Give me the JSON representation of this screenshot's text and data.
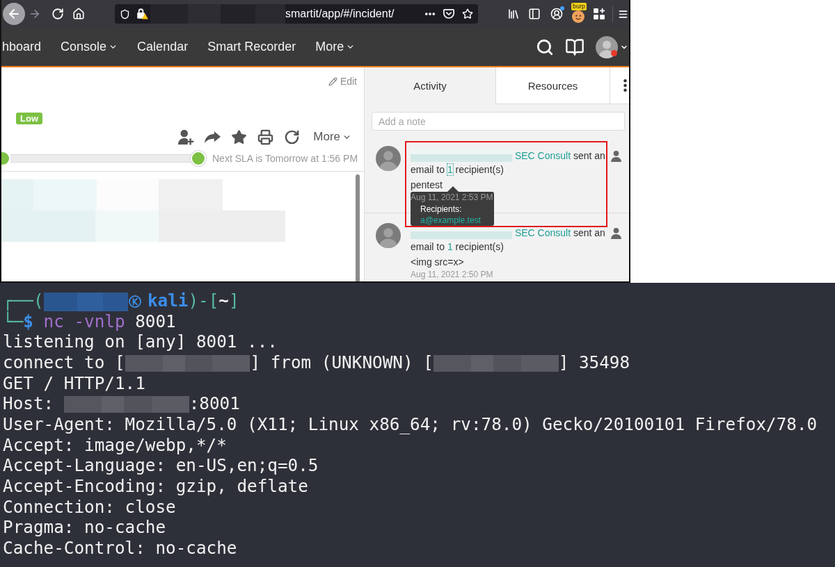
{
  "browser": {
    "toolbar": {
      "url": "smartit/app/#/incident/",
      "extension_badge": "burp"
    },
    "nav": {
      "items": [
        {
          "label": "hboard",
          "dropdown": false
        },
        {
          "label": "Console",
          "dropdown": true
        },
        {
          "label": "Calendar",
          "dropdown": false
        },
        {
          "label": "Smart Recorder",
          "dropdown": false
        },
        {
          "label": "More",
          "dropdown": true
        }
      ]
    },
    "incident": {
      "edit": "Edit",
      "priority": "Low",
      "more": "More",
      "sla": "Next SLA is Tomorrow at 1:56 PM"
    },
    "activity_panel": {
      "tabs": [
        {
          "label": "Activity",
          "selected": true
        },
        {
          "label": "Resources",
          "selected": false
        }
      ],
      "note": {
        "placeholder": "Add a note"
      },
      "entries": [
        {
          "author": "SEC Consult",
          "action": "sent an email to",
          "count": "1",
          "count_suffix": "recipient(s)",
          "count_focused": true,
          "body": "pentest",
          "time": "Aug 11, 2021 2:53 PM",
          "highlighted": true,
          "tooltip": {
            "title": "Recipients:",
            "recipient": "a@example.test"
          }
        },
        {
          "author": "SEC Consult",
          "action": "sent an email to",
          "count": "1",
          "count_suffix": "recipient(s)",
          "count_focused": false,
          "body": "<img src=x>",
          "time": "Aug 11, 2021 2:50 PM",
          "highlighted": false
        }
      ]
    }
  },
  "terminal": {
    "prompt": {
      "corner_top": "┌──(",
      "host": "kali",
      "bracket_open": ")-[",
      "directory": "~",
      "bracket_close": "]",
      "corner_bottom": "└─",
      "symbol": "$",
      "command": "nc -vnlp",
      "argument": "8001"
    },
    "lines": [
      [
        {
          "kind": "text",
          "text": "listening on [any] 8001 ..."
        }
      ],
      [
        {
          "kind": "text",
          "text": "connect to ["
        },
        {
          "kind": "redacted"
        },
        {
          "kind": "text",
          "text": "] from (UNKNOWN) ["
        },
        {
          "kind": "redacted"
        },
        {
          "kind": "text",
          "text": "] 35498"
        }
      ],
      [
        {
          "kind": "text",
          "text": "GET / HTTP/1.1"
        }
      ],
      [
        {
          "kind": "text",
          "text": "Host: "
        },
        {
          "kind": "redacted"
        },
        {
          "kind": "text",
          "text": ":8001"
        }
      ],
      [
        {
          "kind": "text",
          "text": "User-Agent: Mozilla/5.0 (X11; Linux x86_64; rv:78.0) Gecko/20100101 Firefox/78.0"
        }
      ],
      [
        {
          "kind": "text",
          "text": "Accept: image/webp,*/*"
        }
      ],
      [
        {
          "kind": "text",
          "text": "Accept-Language: en-US,en;q=0.5"
        }
      ],
      [
        {
          "kind": "text",
          "text": "Accept-Encoding: gzip, deflate"
        }
      ],
      [
        {
          "kind": "text",
          "text": "Connection: close"
        }
      ],
      [
        {
          "kind": "text",
          "text": "Pragma: no-cache"
        }
      ],
      [
        {
          "kind": "text",
          "text": "Cache-Control: no-cache"
        }
      ]
    ]
  }
}
